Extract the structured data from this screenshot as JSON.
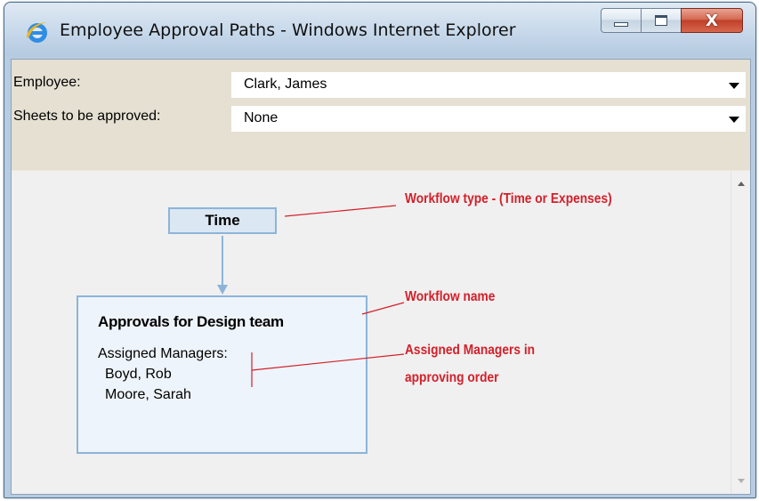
{
  "window": {
    "title": "Employee Approval Paths - Windows Internet Explorer",
    "close_glyph": "X"
  },
  "form": {
    "employee_label": "Employee:",
    "employee_value": "Clark, James",
    "sheets_label": "Sheets to be approved:",
    "sheets_value": "None"
  },
  "diagram": {
    "workflow_type": "Time",
    "workflow_name": "Approvals for Design team",
    "assigned_label": "Assigned Managers:",
    "managers": [
      "Boyd, Rob",
      "Moore, Sarah"
    ]
  },
  "annotations": {
    "workflow_type_note": "Workflow type - (Time or Expenses)",
    "workflow_name_note": "Workflow name",
    "managers_note_line1": "Assigned Managers in",
    "managers_note_line2": "approving order"
  },
  "colors": {
    "annotation": "#d3202a",
    "box_border": "#8db4d8",
    "box_fill": "#eef4fb"
  }
}
